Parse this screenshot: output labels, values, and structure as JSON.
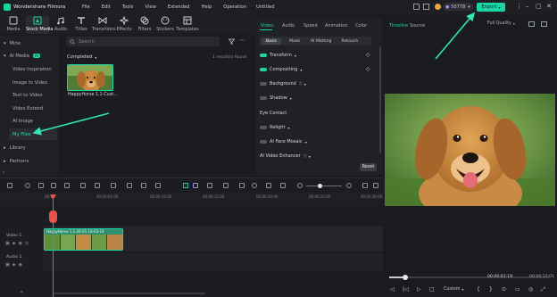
{
  "app": {
    "title": "Wondershare Filmora",
    "menu": [
      "File",
      "Edit",
      "Tools",
      "View",
      "Extended",
      "Help",
      "Operation"
    ],
    "project_title": "Untitled",
    "coins": "50778",
    "export_label": "Export"
  },
  "toolbar": {
    "items": [
      {
        "label": "Media",
        "icon": "media-icon"
      },
      {
        "label": "Stock Media",
        "icon": "stock-media-icon"
      },
      {
        "label": "Audio",
        "icon": "audio-icon"
      },
      {
        "label": "Titles",
        "icon": "titles-icon"
      },
      {
        "label": "Transitions",
        "icon": "transitions-icon"
      },
      {
        "label": "Effects",
        "icon": "effects-icon"
      },
      {
        "label": "Filters",
        "icon": "filters-icon"
      },
      {
        "label": "Stickers",
        "icon": "stickers-icon"
      },
      {
        "label": "Templates",
        "icon": "templates-icon"
      }
    ]
  },
  "sidebar": {
    "items": [
      {
        "label": "Mine",
        "prefix": "▾"
      },
      {
        "label": "AI Media",
        "prefix": "▾",
        "badge": "AI"
      },
      {
        "label": "Video Inspiration",
        "prefix": ""
      },
      {
        "label": "Image to Video",
        "prefix": ""
      },
      {
        "label": "Text to Video",
        "prefix": ""
      },
      {
        "label": "Video Extend",
        "prefix": ""
      },
      {
        "label": "AI Image",
        "prefix": ""
      },
      {
        "label": "My Files",
        "prefix": ""
      },
      {
        "label": "Library",
        "prefix": "▸"
      },
      {
        "label": "Partners",
        "prefix": "▸"
      }
    ]
  },
  "media": {
    "search_placeholder": "Search",
    "filter_label": "Completed",
    "count_text": "1 result(s) found",
    "thumb_title": "HappyHorse 1.1-Cust..."
  },
  "properties": {
    "tabs": [
      "Video",
      "Audio",
      "Speed",
      "Animation",
      "Color"
    ],
    "subtabs": [
      "Basic",
      "Mask",
      "AI Matting",
      "Retouch"
    ],
    "rows": [
      {
        "label": "Transform",
        "toggle": "on"
      },
      {
        "label": "Compositing",
        "toggle": "on"
      },
      {
        "label": "Background",
        "toggle": "off"
      },
      {
        "label": "Shadow",
        "toggle": "off"
      },
      {
        "label": "Eye Contact",
        "toggle": "none"
      },
      {
        "label": "Relight",
        "toggle": "off"
      },
      {
        "label": "AI Face Mosaic",
        "toggle": "off"
      },
      {
        "label": "AI Video Enhancer",
        "toggle": "none"
      }
    ],
    "reset_label": "Reset"
  },
  "preview": {
    "tabs": [
      "Timeline",
      "Source"
    ],
    "quality": "Full Quality",
    "current_time": "00:00:01:19",
    "total_time": "00:00:15:01",
    "zoom_mode": "Custom",
    "progress": 0.1
  },
  "timeline": {
    "ruler": [
      "00:00",
      "00:00:05:00",
      "00:00:10:00",
      "00:00:15:00",
      "00:00:20:00",
      "00:00:25:00",
      "00:00:30:00",
      "00:00:35:00"
    ],
    "clip_label": "HappyHorse 1.1-26-01 16-03-14",
    "video_track": "Video 1",
    "audio_track": "Audio 1"
  },
  "colors": {
    "accent": "#19d6a6",
    "playhead": "#e5534b"
  }
}
